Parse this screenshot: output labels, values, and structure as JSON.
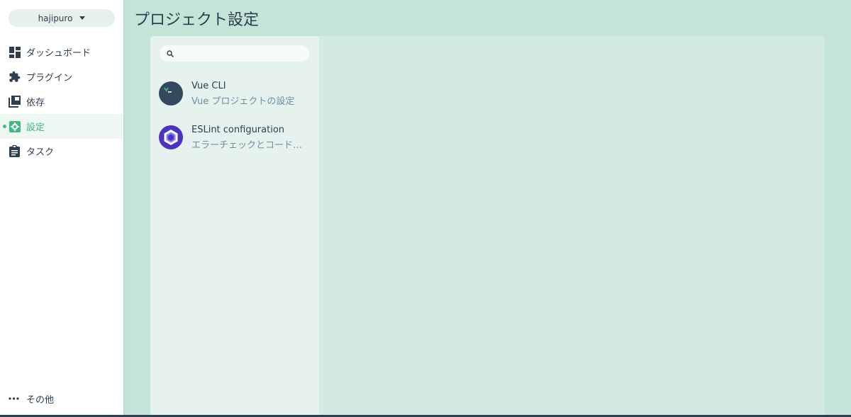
{
  "project": {
    "name": "hajipuro"
  },
  "nav": [
    {
      "label": "ダッシュボード",
      "icon": "dashboard-icon",
      "active": false
    },
    {
      "label": "プラグイン",
      "icon": "puzzle-icon",
      "active": false
    },
    {
      "label": "依存",
      "icon": "library-icon",
      "active": false
    },
    {
      "label": "設定",
      "icon": "settings-icon",
      "active": true
    },
    {
      "label": "タスク",
      "icon": "clipboard-icon",
      "active": false
    }
  ],
  "more": {
    "label": "その他"
  },
  "page": {
    "title": "プロジェクト設定"
  },
  "search": {
    "value": "",
    "placeholder": ""
  },
  "plugins": [
    {
      "name": "Vue CLI",
      "description": "Vue プロジェクトの設定",
      "icon": "terminal-icon"
    },
    {
      "name": "ESLint configuration",
      "description": "エラーチェックとコード品質",
      "icon": "eslint-icon"
    }
  ],
  "colors": {
    "accent": "#42b983",
    "text": "#2c3e50",
    "background": "#c5e4d8",
    "panel": "#d2eae1"
  }
}
